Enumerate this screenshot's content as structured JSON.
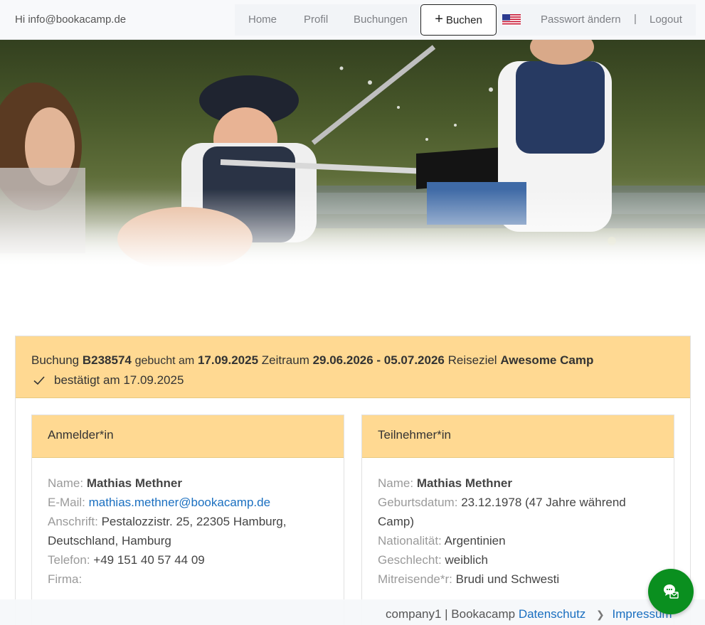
{
  "header": {
    "greeting": "Hi info@bookacamp.de",
    "nav": {
      "home": "Home",
      "profil": "Profil",
      "buchungen": "Buchungen",
      "buchen": "Buchen",
      "passwort": "Passwort ändern",
      "separator": "|",
      "logout": "Logout"
    },
    "language_flag_icon": "us-flag-icon"
  },
  "booking": {
    "label_buchung": "Buchung",
    "id": "B238574",
    "label_gebucht": "gebucht am",
    "booked_date": "17.09.2025",
    "label_zeitraum": "Zeitraum",
    "period": "29.06.2026 - 05.07.2026",
    "label_reiseziel": "Reiseziel",
    "destination": "Awesome Camp",
    "status": "bestätigt am 17.09.2025"
  },
  "applicant": {
    "title": "Anmelder*in",
    "name_label": "Name:",
    "name": "Mathias Methner",
    "email_label": "E-Mail:",
    "email": "mathias.methner@bookacamp.de",
    "address_label": "Anschrift:",
    "address": "Pestalozzistr. 25, 22305 Hamburg, Deutschland, Hamburg",
    "phone_label": "Telefon:",
    "phone": "+49 151 40 57 44 09",
    "company_label": "Firma:"
  },
  "participant": {
    "title": "Teilnehmer*in",
    "name_label": "Name:",
    "name": "Mathias Methner",
    "birth_label": "Geburtsdatum:",
    "birth": "23.12.1978 (47 Jahre während Camp)",
    "nationality_label": "Nationalität:",
    "nationality": "Argentinien",
    "gender_label": "Geschlecht:",
    "gender": "weiblich",
    "companions_label": "Mitreisende*r:",
    "companions": "Brudi und Schwesti"
  },
  "footer": {
    "company": "company1 | Bookacamp",
    "privacy": "Datenschutz",
    "imprint": "Impressum"
  },
  "colors": {
    "card_header": "#ffd992",
    "link": "#1a6fc0",
    "chat_button": "#0a8f1f"
  }
}
